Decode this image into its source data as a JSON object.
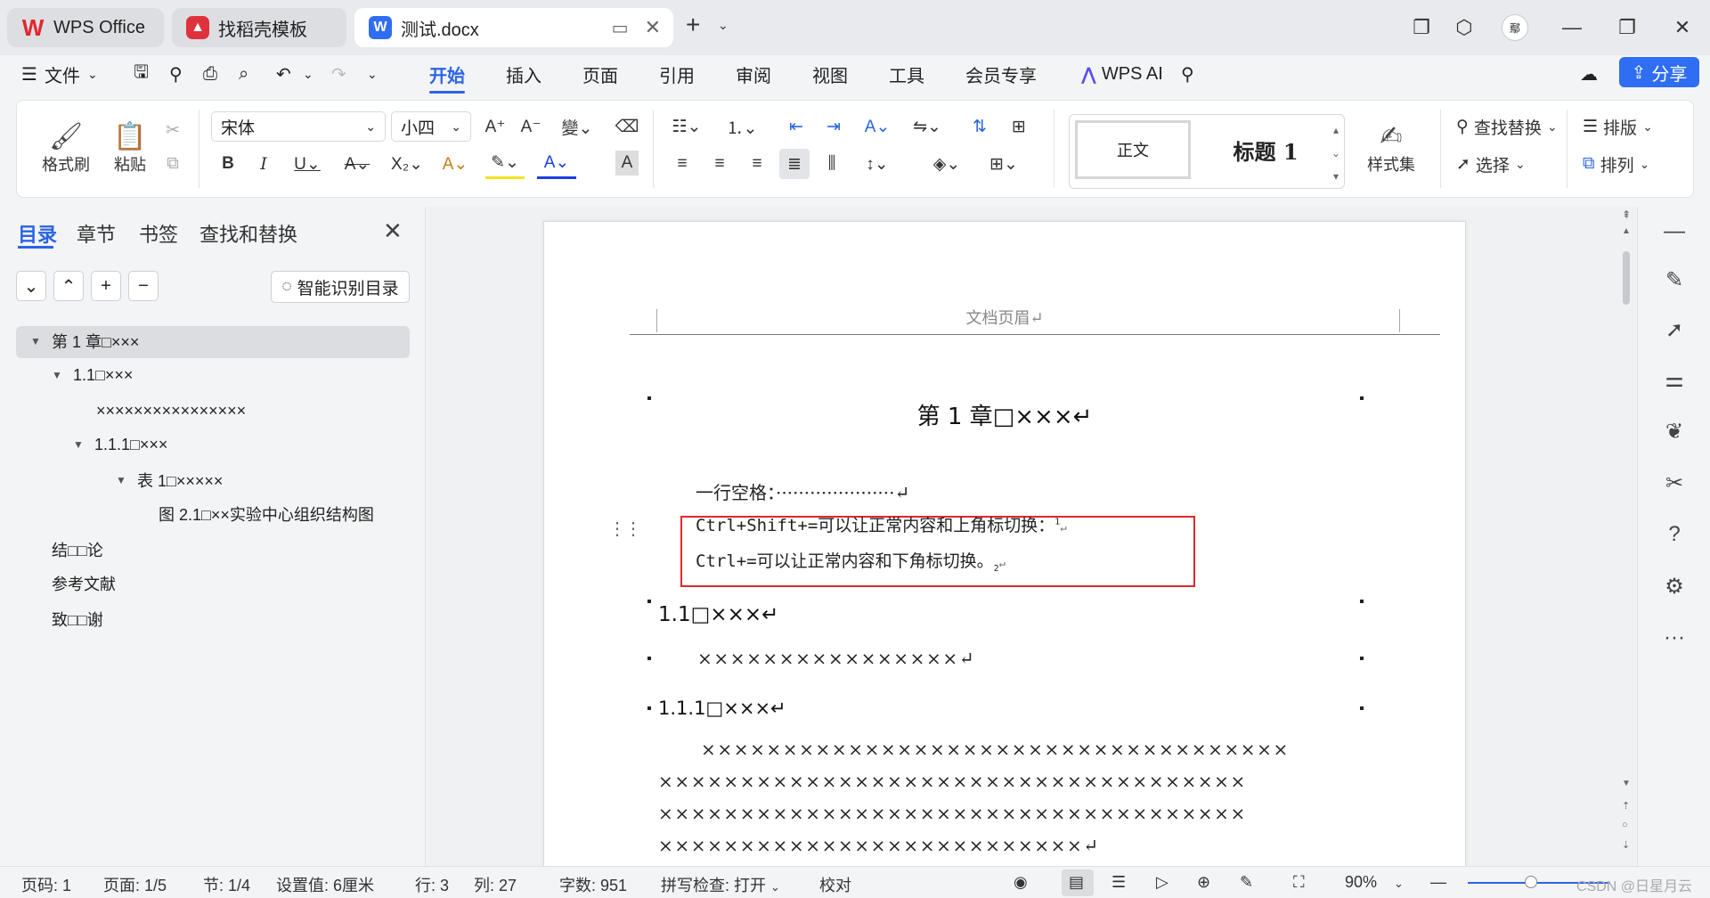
{
  "titlebar": {
    "tabs": [
      {
        "label": "WPS Office",
        "icon": "wps-logo-icon"
      },
      {
        "label": "找稻壳模板",
        "icon": "docer-template-icon"
      },
      {
        "label": "测试.docx",
        "icon": "word-doc-icon"
      }
    ],
    "avatar_text": "鄢"
  },
  "menubar": {
    "file_label": "文件",
    "tabs": [
      "开始",
      "插入",
      "页面",
      "引用",
      "审阅",
      "视图",
      "工具",
      "会员专享"
    ],
    "active_tab": "开始",
    "wps_ai_label": "WPS AI",
    "share_label": "分享"
  },
  "ribbon": {
    "format_painter_label": "格式刷",
    "paste_label": "粘贴",
    "font_name": "宋体",
    "font_size": "小四",
    "style_normal": "正文",
    "style_heading1": "标题 1",
    "style_set_label": "样式集",
    "find_replace_label": "查找替换",
    "select_label": "选择",
    "layout_label": "排版",
    "arrange_label": "排列",
    "accent_color": "#2a64e6"
  },
  "navpane": {
    "tabs": [
      "目录",
      "章节",
      "书签",
      "查找和替换"
    ],
    "smart_toc_label": "智能识别目录",
    "toc": [
      {
        "text": "第 1 章□×××"
      },
      {
        "text": "1.1□×××"
      },
      {
        "text": "××××××××××××××××"
      },
      {
        "text": "1.1.1□×××"
      },
      {
        "text": "表 1□×××××"
      },
      {
        "text": "图 2.1□××实验中心组织结构图"
      },
      {
        "text": "结□□论"
      },
      {
        "text": "参考文献"
      },
      {
        "text": "致□□谢"
      }
    ]
  },
  "document": {
    "header_text": "文档页眉↵",
    "chapter_title": "第 1 章□×××↵",
    "line_empty": "一行空格：·····················↵",
    "line_sup_text": "Ctrl+Shift+=可以让正常内容和上角标切换：",
    "line_sup_mark": "1",
    "line_sub_text": "Ctrl+=可以让正常内容和下角标切换。",
    "line_sub_mark": "2",
    "heading_11": "1.1□×××↵",
    "para_11": "××××××××××××××××↵",
    "heading_111": "1.1.1□×××↵",
    "body_lines": [
      "××××××××××××××××××××××××××××××××××××",
      "××××××××××××××××××××××××××××××××××××",
      "××××××××××××××××××××××××××××××××××××",
      "××××××××××××××××××××××××××↵"
    ],
    "highlight_color": "#e1262d"
  },
  "statusbar": {
    "page_code": "页码: 1",
    "page": "页面: 1/5",
    "section": "节: 1/4",
    "setting": "设置值: 6厘米",
    "row": "行: 3",
    "col": "列: 27",
    "word_count": "字数: 951",
    "spell_check": "拼写检查: 打开",
    "proofread": "校对",
    "zoom": "90%",
    "watermark": "CSDN @日星月云"
  }
}
